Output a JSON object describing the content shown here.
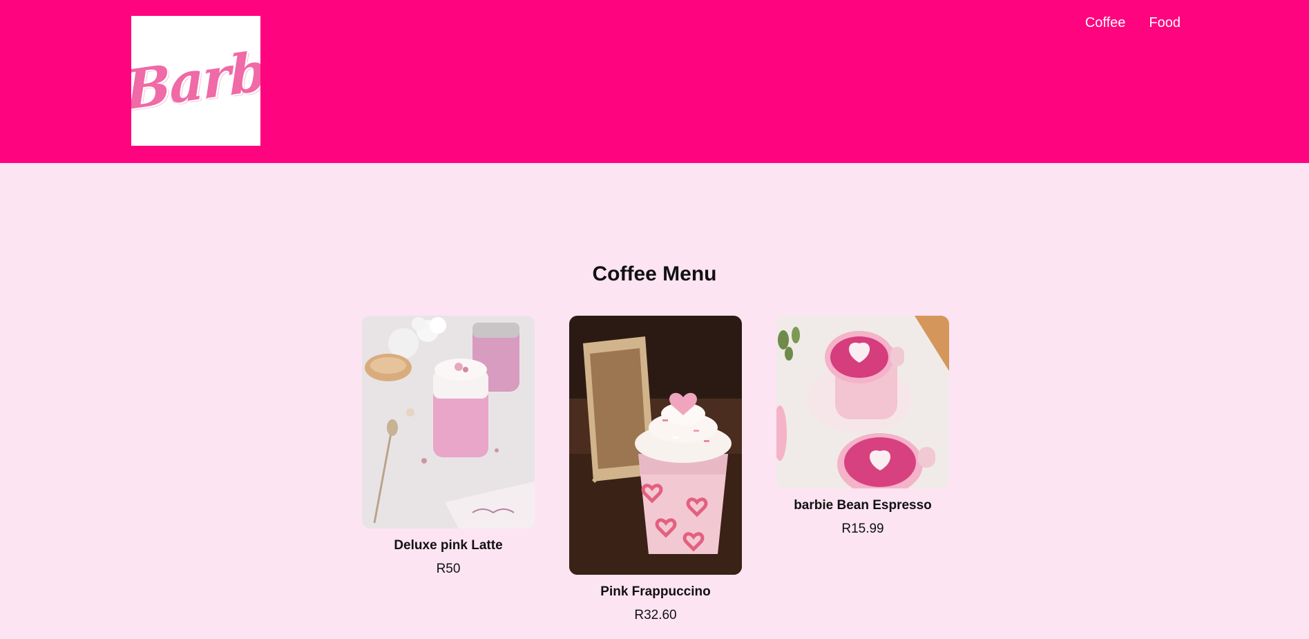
{
  "brand": {
    "logo_text": "Barb"
  },
  "nav": {
    "items": [
      {
        "label": "Coffee"
      },
      {
        "label": "Food"
      }
    ]
  },
  "colors": {
    "header": "#ff047f",
    "background": "#fde4f2",
    "nav_text": "#ffffff"
  },
  "menu": {
    "title": "Coffee Menu",
    "items": [
      {
        "name": "Deluxe pink Latte",
        "price": "R50"
      },
      {
        "name": "Pink Frappuccino",
        "price": "R32.60"
      },
      {
        "name": "barbie Bean Espresso",
        "price": "R15.99"
      }
    ]
  }
}
